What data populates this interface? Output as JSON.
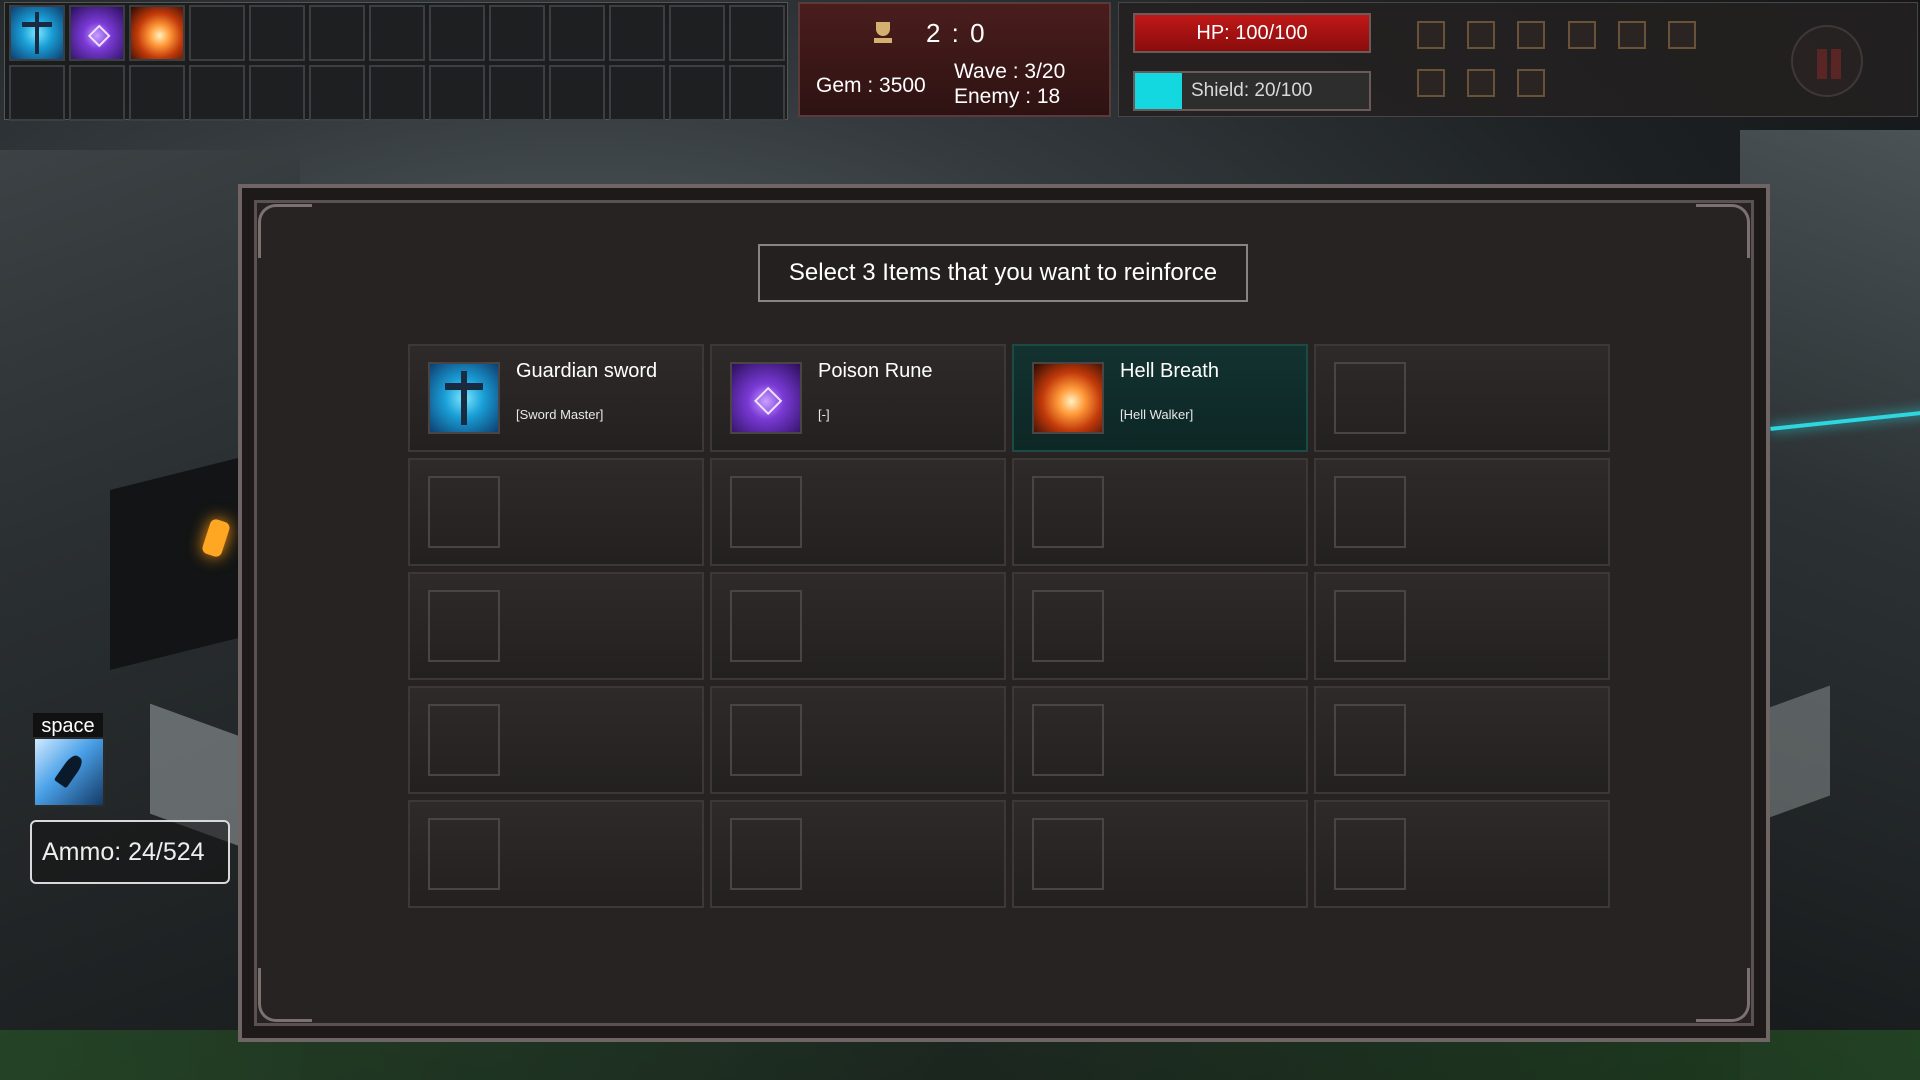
{
  "colors": {
    "accent_selected": "#123230",
    "hp": "#c01818",
    "shield": "#13d8df",
    "panel_red": "#4a1d1d"
  },
  "inventory": {
    "slots": [
      {
        "icon": "guardian-sword-icon"
      },
      {
        "icon": "poison-rune-icon"
      },
      {
        "icon": "hell-breath-icon"
      }
    ],
    "empty_slot_count": 23
  },
  "score": {
    "icon": "trophy-icon",
    "value": "2 : 0",
    "gem": "Gem : 3500",
    "wave": "Wave : 3/20",
    "enemy": "Enemy : 18"
  },
  "status": {
    "hp_label": "HP: 100/100",
    "hp_fraction": 1.0,
    "shield_label": "Shield: 20/100",
    "shield_fraction": 0.2,
    "buff_icons": [
      "buff-icon",
      "buff-icon",
      "buff-icon",
      "buff-icon",
      "buff-icon",
      "buff-icon",
      "buff-icon",
      "buff-icon",
      "buff-icon"
    ]
  },
  "skill": {
    "key_label": "space",
    "icon": "dash-icon"
  },
  "ammo": {
    "label": "Ammo: 24/524"
  },
  "reinforce": {
    "title": "Select 3 Items that you want to reinforce",
    "items": [
      {
        "name": "Guardian sword",
        "tag": "[Sword Master]",
        "icon": "guardian-sword-icon",
        "selected": false
      },
      {
        "name": "Poison Rune",
        "tag": "[-]",
        "icon": "poison-rune-icon",
        "selected": false
      },
      {
        "name": "Hell Breath",
        "tag": "[Hell Walker]",
        "icon": "hell-breath-icon",
        "selected": true
      }
    ],
    "total_cells": 20
  }
}
